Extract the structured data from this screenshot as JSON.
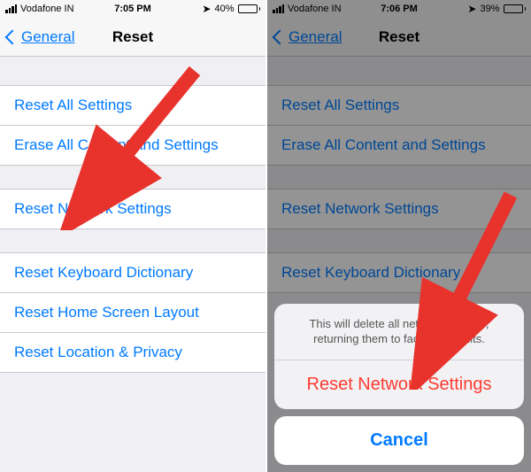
{
  "left": {
    "statusbar": {
      "carrier": "Vodafone IN",
      "time": "7:05 PM",
      "battery": "40%",
      "battery_fill": 40
    },
    "navbar": {
      "back": "General",
      "title": "Reset"
    },
    "group1": [
      {
        "label": "Reset All Settings"
      },
      {
        "label": "Erase All Content and Settings"
      }
    ],
    "group2": [
      {
        "label": "Reset Network Settings"
      }
    ],
    "group3": [
      {
        "label": "Reset Keyboard Dictionary"
      },
      {
        "label": "Reset Home Screen Layout"
      },
      {
        "label": "Reset Location & Privacy"
      }
    ]
  },
  "right": {
    "statusbar": {
      "carrier": "Vodafone IN",
      "time": "7:06 PM",
      "battery": "39%",
      "battery_fill": 39
    },
    "navbar": {
      "back": "General",
      "title": "Reset"
    },
    "group1": [
      {
        "label": "Reset All Settings"
      },
      {
        "label": "Erase All Content and Settings"
      }
    ],
    "group2": [
      {
        "label": "Reset Network Settings"
      }
    ],
    "group3": [
      {
        "label": "Reset Keyboard Dictionary"
      }
    ],
    "sheet": {
      "message": "This will delete all network settings, returning them to factory defaults.",
      "action": "Reset Network Settings",
      "cancel": "Cancel"
    }
  }
}
